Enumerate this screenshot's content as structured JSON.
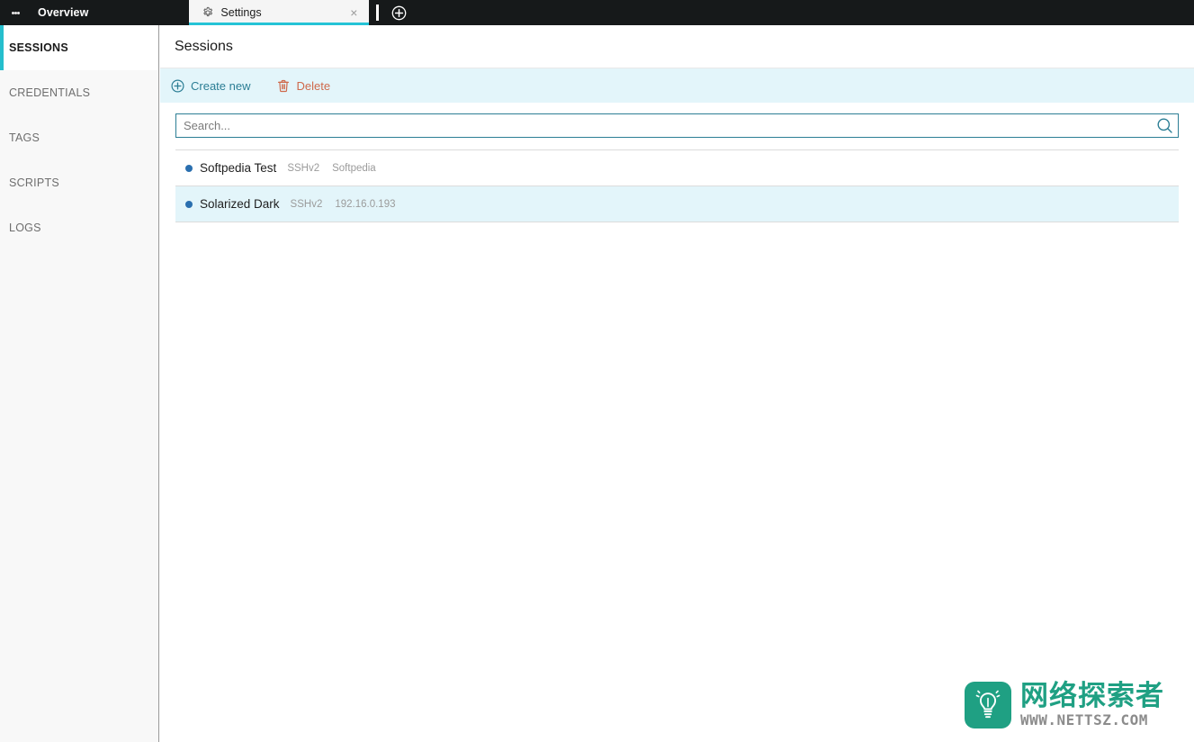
{
  "titlebar": {
    "menu_icon": "kebab-menu-icon",
    "overview_label": "Overview",
    "tabs": [
      {
        "label": "Settings",
        "icon": "gear-icon",
        "close_label": "×",
        "active": true
      }
    ],
    "new_tab_icon": "plus-circle-icon"
  },
  "sidebar": {
    "items": [
      {
        "label": "SESSIONS",
        "active": true
      },
      {
        "label": "CREDENTIALS",
        "active": false
      },
      {
        "label": "TAGS",
        "active": false
      },
      {
        "label": "SCRIPTS",
        "active": false
      },
      {
        "label": "LOGS",
        "active": false
      }
    ]
  },
  "main": {
    "page_title": "Sessions",
    "toolbar": {
      "create_label": "Create new",
      "create_icon": "plus-circle-icon",
      "delete_label": "Delete",
      "delete_icon": "trash-icon"
    },
    "search": {
      "placeholder": "Search...",
      "value": "",
      "icon": "search-icon"
    },
    "sessions": [
      {
        "name": "Softpedia Test",
        "protocol": "SSHv2",
        "host": "Softpedia",
        "selected": false,
        "status": "connected"
      },
      {
        "name": "Solarized Dark",
        "protocol": "SSHv2",
        "host": "192.16.0.193",
        "selected": true,
        "status": "connected"
      }
    ]
  },
  "watermark": {
    "cn_text": "网络探索者",
    "url_text": "WWW.NETTSZ.COM",
    "logo_icon": "lightbulb-icon"
  },
  "colors": {
    "accent_teal": "#25becd",
    "link_blue": "#2c7e95",
    "delete_orange": "#cf6a4c",
    "highlight_bg": "#e3f5fa",
    "titlebar_bg": "#16191a",
    "status_dot": "#2a6faf",
    "watermark_green": "#1fa083"
  }
}
